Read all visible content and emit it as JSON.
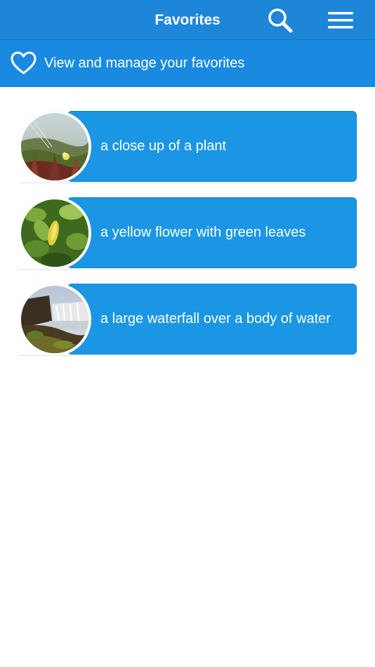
{
  "navbar": {
    "title": "Favorites",
    "search_icon": "search-icon",
    "menu_icon": "hamburger-menu-icon",
    "color": "#1d86d8"
  },
  "subheader": {
    "icon": "heart-outline-icon",
    "text": "View and manage your favorites",
    "color": "#1a8ae0"
  },
  "favorites": [
    {
      "caption": "a close up of a plant",
      "thumbnail": "plant-thumbnail"
    },
    {
      "caption": "a yellow flower with green leaves",
      "thumbnail": "yellow-flower-thumbnail"
    },
    {
      "caption": "a large waterfall over a body of water",
      "thumbnail": "waterfall-thumbnail"
    }
  ],
  "card_color": "#1a96e4"
}
